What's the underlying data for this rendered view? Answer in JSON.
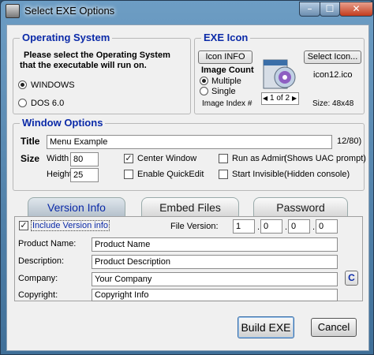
{
  "window": {
    "title": "Select EXE Options",
    "controls": {
      "minimize": "–",
      "maximize": "☐",
      "close": "✕"
    }
  },
  "os_group": {
    "title": "Operating System",
    "prompt_line1": "Please select the Operating System",
    "prompt_line2": "that the executable will run on.",
    "options": [
      "WINDOWS",
      "DOS 6.0"
    ],
    "selected": "WINDOWS"
  },
  "exe_icon": {
    "title": "EXE Icon",
    "icon_info_button": "Icon INFO",
    "select_icon_button": "Select Icon...",
    "image_count_label": "Image Count",
    "multiple_label": "Multiple",
    "single_label": "Single",
    "image_count_selected": "Multiple",
    "image_index_label": "Image Index #",
    "index_value": "1 of 2",
    "filename": "icon12.ico",
    "size_text": "Size: 48x48"
  },
  "window_options": {
    "title": "Window Options",
    "title_label": "Title",
    "title_value": "Menu Example",
    "title_counter": "12/80)",
    "size_label": "Size",
    "width_label": "Width",
    "width_value": "80",
    "height_label": "Height",
    "height_value": "25",
    "center_window": "Center Window",
    "center_window_checked": true,
    "enable_quickedit": "Enable QuickEdit",
    "enable_quickedit_checked": false,
    "run_as_admin": "Run as Admin",
    "run_as_admin_note": "(Shows UAC prompt)",
    "run_as_admin_checked": false,
    "start_invisible": "Start Invisible",
    "start_invisible_note": "(Hidden console)",
    "start_invisible_checked": false
  },
  "tabs": [
    {
      "label": "Version Info",
      "active": true
    },
    {
      "label": "Embed Files",
      "active": false
    },
    {
      "label": "Password",
      "active": false
    }
  ],
  "version_info": {
    "include_label": "Include Version info",
    "include_checked": true,
    "file_version_label": "File Version:",
    "file_version": [
      "1",
      "0",
      "0",
      "0"
    ],
    "version_sep": ".",
    "product_name_label": "Product Name:",
    "product_name": "Product Name",
    "description_label": "Description:",
    "description": "Product Description",
    "company_label": "Company:",
    "company": "Your Company",
    "copyright_label": "Copyright:",
    "copyright": "Copyright Info",
    "copyright_button": "C"
  },
  "footer": {
    "build_button": "Build EXE",
    "cancel_button": "Cancel"
  },
  "check_mark": "✓"
}
